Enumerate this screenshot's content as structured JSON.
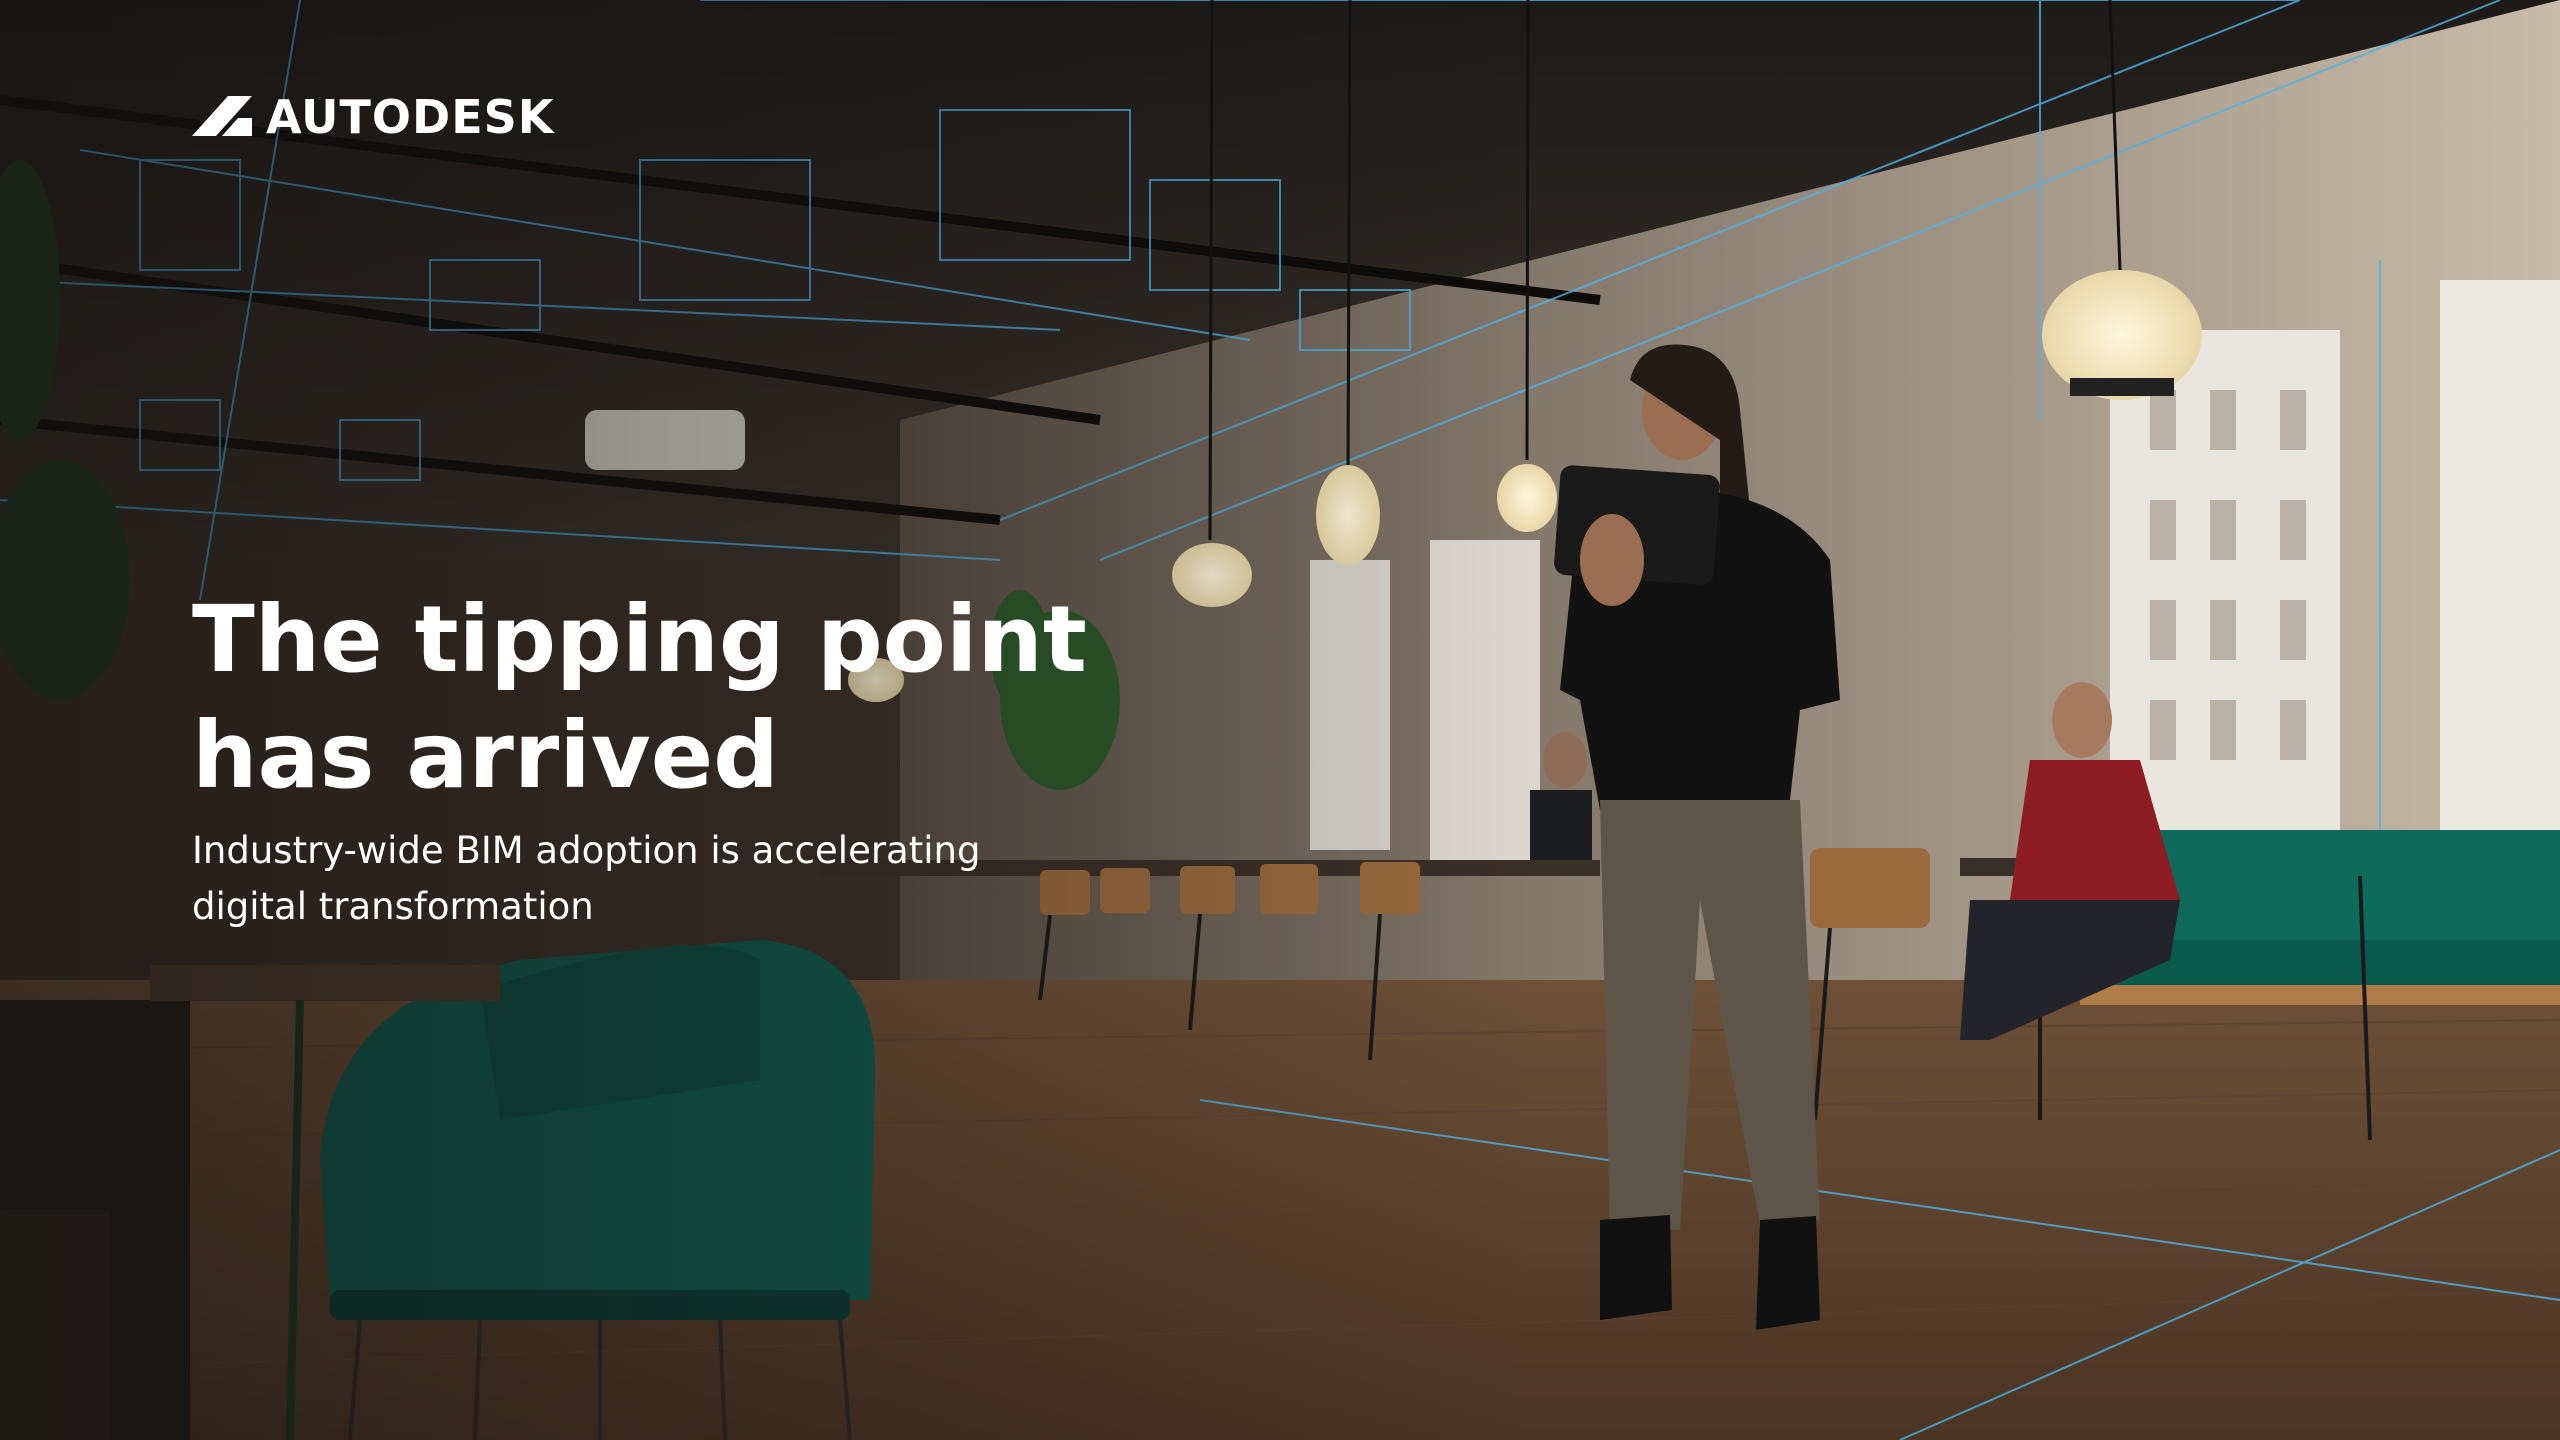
{
  "brand": {
    "name": "AUTODESK",
    "icon": "autodesk-logo-icon"
  },
  "hero": {
    "headline_line1": "The tipping point",
    "headline_line2": "has arrived",
    "subhead_line1": "Industry-wide BIM adoption is accelerating",
    "subhead_line2": "digital transformation"
  },
  "colors": {
    "text": "#ffffff",
    "wireframe": "#4fb3e8",
    "upholstery": "#0f6b5c",
    "floor": "#7a5a3e"
  }
}
